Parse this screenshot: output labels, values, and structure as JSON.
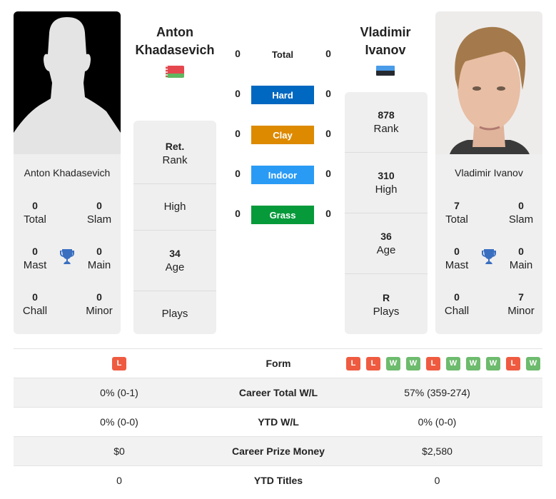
{
  "player1": {
    "name_line1": "Anton",
    "name_line2": "Khadasevich",
    "full_name": "Anton Khadasevich",
    "country_flag": "belarus-flag",
    "titles": {
      "total": "0",
      "total_label": "Total",
      "slam": "0",
      "slam_label": "Slam",
      "mast": "0",
      "mast_label": "Mast",
      "main": "0",
      "main_label": "Main",
      "chall": "0",
      "chall_label": "Chall",
      "minor": "0",
      "minor_label": "Minor"
    },
    "stats": [
      {
        "value": "Ret.",
        "label": "Rank"
      },
      {
        "value": "",
        "label": "High"
      },
      {
        "value": "34",
        "label": "Age"
      },
      {
        "value": "",
        "label": "Plays"
      }
    ]
  },
  "player2": {
    "name_line1": "Vladimir",
    "name_line2": "Ivanov",
    "full_name": "Vladimir Ivanov",
    "country_flag": "estonia-flag",
    "titles": {
      "total": "7",
      "total_label": "Total",
      "slam": "0",
      "slam_label": "Slam",
      "mast": "0",
      "mast_label": "Mast",
      "main": "0",
      "main_label": "Main",
      "chall": "0",
      "chall_label": "Chall",
      "minor": "7",
      "minor_label": "Minor"
    },
    "stats": [
      {
        "value": "878",
        "label": "Rank"
      },
      {
        "value": "310",
        "label": "High"
      },
      {
        "value": "36",
        "label": "Age"
      },
      {
        "value": "R",
        "label": "Plays"
      }
    ]
  },
  "h2h": {
    "total_label": "Total",
    "total_p1": "0",
    "total_p2": "0",
    "surfaces": [
      {
        "label": "Hard",
        "p1": "0",
        "p2": "0",
        "color": "#0068c0"
      },
      {
        "label": "Clay",
        "p1": "0",
        "p2": "0",
        "color": "#dd8a00"
      },
      {
        "label": "Indoor",
        "p1": "0",
        "p2": "0",
        "color": "#2a9bf5"
      },
      {
        "label": "Grass",
        "p1": "0",
        "p2": "0",
        "color": "#069a3a"
      }
    ]
  },
  "comparison": {
    "form_label": "Form",
    "p1_form": [
      "L"
    ],
    "p2_form": [
      "L",
      "L",
      "W",
      "W",
      "L",
      "W",
      "W",
      "W",
      "L",
      "W"
    ],
    "rows": [
      {
        "label": "Career Total W/L",
        "p1": "0% (0-1)",
        "p2": "57% (359-274)"
      },
      {
        "label": "YTD W/L",
        "p1": "0% (0-0)",
        "p2": "0% (0-0)"
      },
      {
        "label": "Career Prize Money",
        "p1": "$0",
        "p2": "$2,580"
      },
      {
        "label": "YTD Titles",
        "p1": "0",
        "p2": "0"
      }
    ]
  }
}
